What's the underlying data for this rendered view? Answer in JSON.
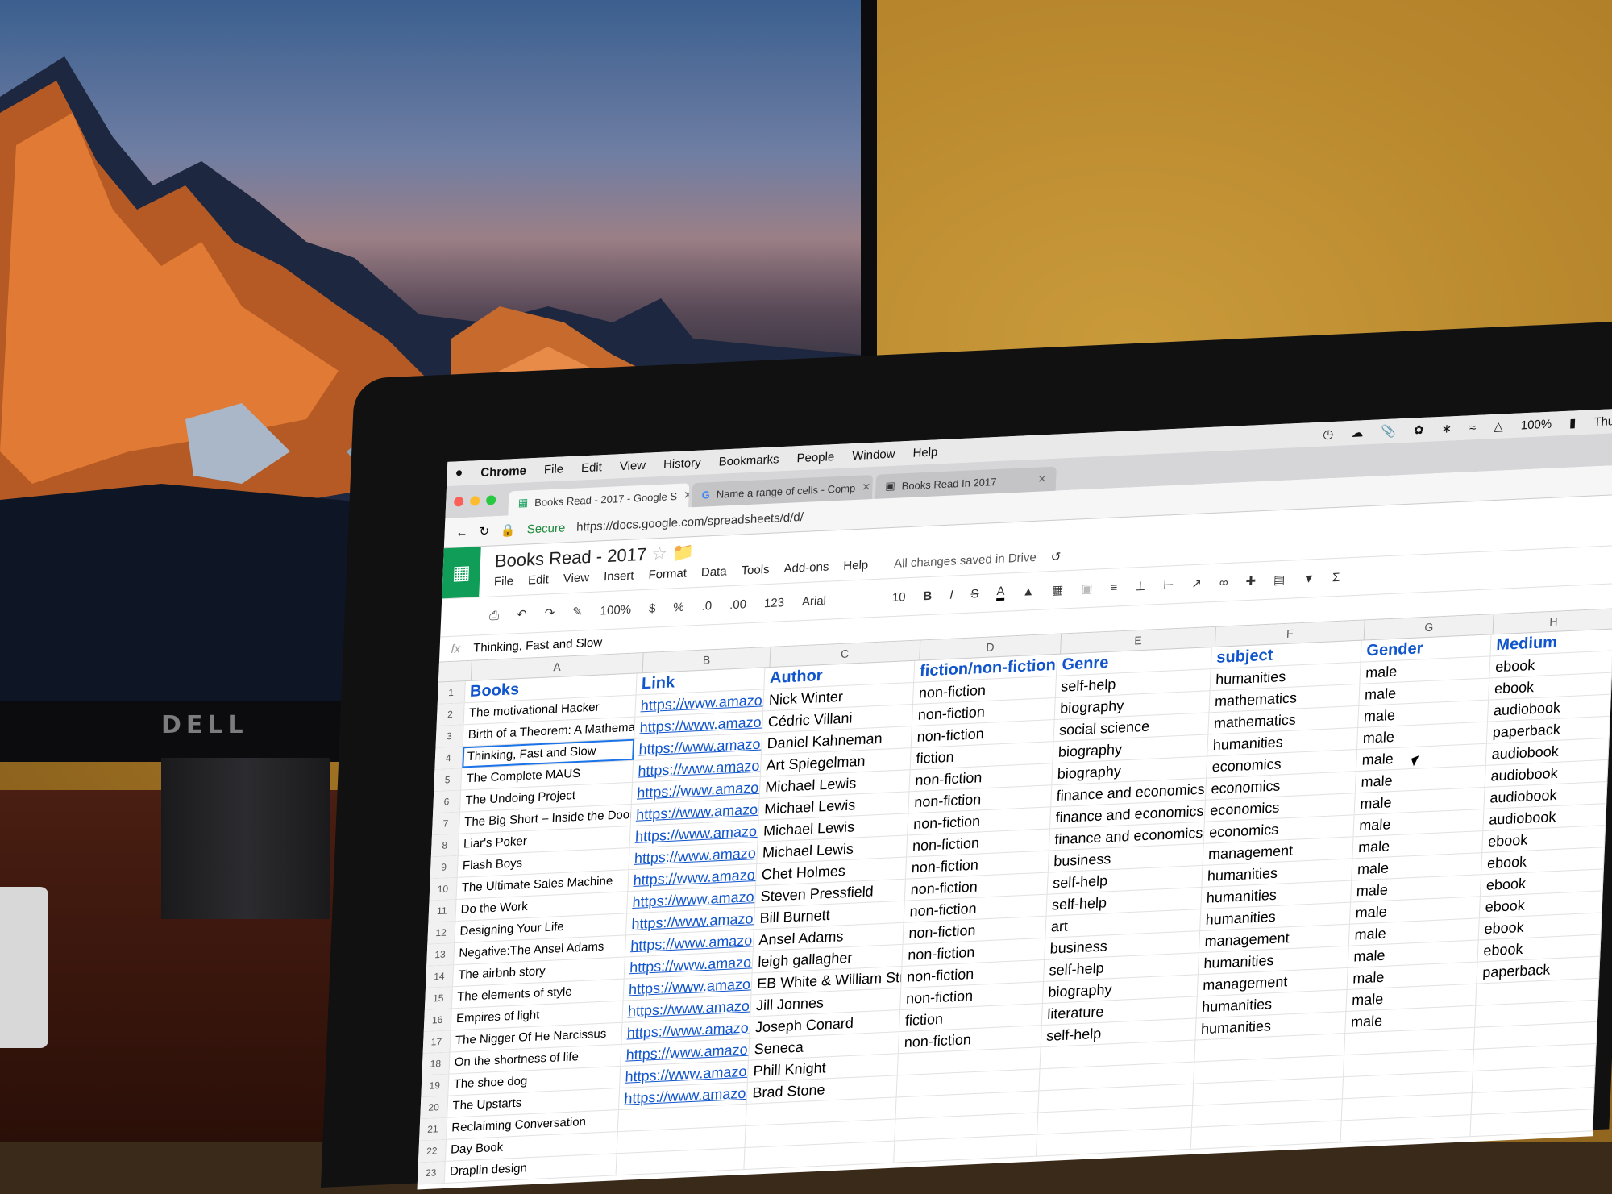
{
  "monitor": {
    "brand": "DELL"
  },
  "mac_menubar": {
    "app": "Chrome",
    "items": [
      "File",
      "Edit",
      "View",
      "History",
      "Bookmarks",
      "People",
      "Window",
      "Help"
    ],
    "battery": "100%",
    "day": "Thu"
  },
  "browser": {
    "tabs": [
      {
        "label": "Books Read - 2017 - Google S"
      },
      {
        "label": "Name a range of cells - Comp"
      },
      {
        "label": "Books Read In 2017"
      }
    ],
    "secure_label": "Secure",
    "url": "https://docs.google.com/spreadsheets/d/d/"
  },
  "sheet": {
    "title": "Books Read - 2017",
    "menu": [
      "File",
      "Edit",
      "View",
      "Insert",
      "Format",
      "Data",
      "Tools",
      "Add-ons",
      "Help"
    ],
    "saved_status": "All changes saved in Drive",
    "toolbar": {
      "zoom": "100%",
      "currency": "$",
      "percent": "%",
      "dec_less": ".0",
      "dec_more": ".00",
      "more_formats": "123",
      "font": "Arial",
      "size": "10",
      "bold": "B",
      "italic": "I",
      "strike": "S",
      "text_color": "A"
    },
    "fx": "fx",
    "formula_value": "Thinking, Fast and Slow",
    "columns": [
      "A",
      "B",
      "C",
      "D",
      "E",
      "F",
      "G",
      "H"
    ],
    "header": [
      "Books",
      "Link",
      "Author",
      "fiction/non-fiction",
      "Genre",
      "subject",
      "Gender",
      "Medium"
    ],
    "rows": [
      [
        "2",
        "The motivational Hacker",
        "https://www.amazon.in/Mc",
        "Nick Winter",
        "non-fiction",
        "self-help",
        "humanities",
        "male",
        "ebook"
      ],
      [
        "3",
        "Birth of a Theorem: A Mathematical Adv",
        "https://www.amazon.in/Bi",
        "Cédric Villani",
        "non-fiction",
        "biography",
        "mathematics",
        "male",
        "ebook"
      ],
      [
        "4",
        "Thinking, Fast and Slow",
        "https://www.amazon.in/Th",
        "Daniel Kahneman",
        "non-fiction",
        "social science",
        "mathematics",
        "male",
        "audiobook"
      ],
      [
        "5",
        "The Complete MAUS",
        "https://www.amazon.in/Cc",
        "Art Spiegelman",
        "fiction",
        "biography",
        "humanities",
        "male",
        "paperback"
      ],
      [
        "6",
        "The Undoing Project",
        "https://www.amazon.in/Ur",
        "Michael Lewis",
        "non-fiction",
        "biography",
        "economics",
        "male",
        "audiobook"
      ],
      [
        "7",
        "The Big Short – Inside the Doomsday M",
        "https://www.amazon.in/Bi",
        "Michael Lewis",
        "non-fiction",
        "finance and economics",
        "economics",
        "male",
        "audiobook"
      ],
      [
        "8",
        "Liar's Poker",
        "https://www.amazon.in/Li",
        "Michael Lewis",
        "non-fiction",
        "finance and economics",
        "economics",
        "male",
        "audiobook"
      ],
      [
        "9",
        "Flash Boys",
        "https://www.amazon.in/Fl",
        "Michael Lewis",
        "non-fiction",
        "finance and economics",
        "economics",
        "male",
        "audiobook"
      ],
      [
        "10",
        "The Ultimate Sales Machine",
        "https://www.amazon.in/Ul",
        "Chet Holmes",
        "non-fiction",
        "business",
        "management",
        "male",
        "ebook"
      ],
      [
        "11",
        "Do the Work",
        "https://www.amazon.in/Dc",
        "Steven Pressfield",
        "non-fiction",
        "self-help",
        "humanities",
        "male",
        "ebook"
      ],
      [
        "12",
        "Designing Your Life",
        "https://www.amazon.in/De",
        "Bill Burnett",
        "non-fiction",
        "self-help",
        "humanities",
        "male",
        "ebook"
      ],
      [
        "13",
        "Negative:The Ansel Adams",
        "https://www.amazon.in/Ne",
        "Ansel Adams",
        "non-fiction",
        "art",
        "humanities",
        "male",
        "ebook"
      ],
      [
        "14",
        "The airbnb story",
        "https://www.amazon.in/Ai",
        "leigh gallagher",
        "non-fiction",
        "business",
        "management",
        "male",
        "ebook"
      ],
      [
        "15",
        "The elements of style",
        "https://www.amazon.in/El",
        "EB White & William Strunk",
        "non-fiction",
        "self-help",
        "humanities",
        "male",
        "ebook"
      ],
      [
        "16",
        "Empires of light",
        "https://www.amazon.in/Er",
        "Jill Jonnes",
        "non-fiction",
        "biography",
        "management",
        "male",
        "paperback"
      ],
      [
        "17",
        "The Nigger Of He Narcissus",
        "https://www.amazon.in/Ni",
        "Joseph Conard",
        "fiction",
        "literature",
        "humanities",
        "male",
        ""
      ],
      [
        "18",
        "On the shortness of life",
        "https://www.amazon.in/Sh",
        "Seneca",
        "non-fiction",
        "self-help",
        "humanities",
        "male",
        ""
      ],
      [
        "19",
        "The shoe dog",
        "https://www.amazon.in/Sh",
        "Phill Knight",
        "",
        "",
        "",
        "",
        ""
      ],
      [
        "20",
        "The Upstarts",
        "https://www.amazon.in/Ur",
        "Brad Stone",
        "",
        "",
        "",
        "",
        ""
      ],
      [
        "21",
        "Reclaiming Conversation",
        "",
        "",
        "",
        "",
        "",
        "",
        ""
      ],
      [
        "22",
        "Day Book",
        "",
        "",
        "",
        "",
        "",
        "",
        ""
      ],
      [
        "23",
        "Draplin design",
        "",
        "",
        "",
        "",
        "",
        "",
        ""
      ]
    ]
  },
  "colors": {
    "sheets_green": "#0f9d58",
    "header_blue": "#1155cc",
    "wall": "#b07e27"
  }
}
